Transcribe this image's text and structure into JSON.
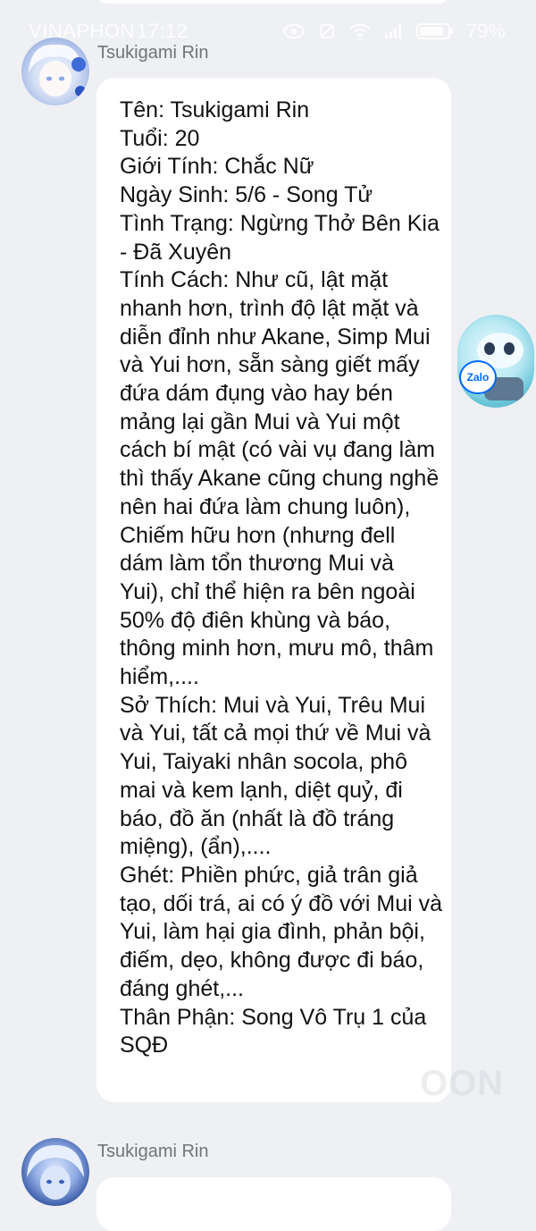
{
  "status_bar": {
    "carrier": "VINAPHON",
    "time": "17:12",
    "battery": "79%"
  },
  "icons": {
    "eye": "eye-icon",
    "mute": "alarm-off-icon",
    "wifi": "wifi-icon",
    "signal": "signal-icon",
    "battery": "battery-icon"
  },
  "chat": {
    "messages": [
      {
        "sender": "Tsukigami Rin",
        "text": "Tên: Tsukigami Rin\nTuổi: 20\nGiới Tính: Chắc Nữ\nNgày Sinh: 5/6 - Song Tử\nTình Trạng: Ngừng Thở Bên Kia - Đã Xuyên\nTính Cách: Như cũ, lật mặt nhanh hơn, trình độ lật mặt và diễn đỉnh như Akane, Simp Mui và Yui hơn, sẵn sàng giết mấy đứa dám đụng vào hay bén mảng lại gần Mui và Yui một cách bí mật (có vài vụ đang làm thì thấy Akane cũng chung nghề nên hai đứa làm chung luôn), Chiếm hữu hơn (nhưng đell dám làm tổn thương Mui và Yui), chỉ thể hiện ra bên ngoài 50% độ điên khùng và báo, thông minh hơn, mưu mô, thâm hiểm,....\nSở Thích: Mui và Yui, Trêu Mui và Yui, tất cả mọi thứ về Mui và Yui, Taiyaki nhân socola, phô mai và kem lạnh, diệt quỷ, đi báo, đồ ăn (nhất là đồ tráng miệng), (ẩn),....\nGhét: Phiền phức, giả trân giả tạo, dối trá, ai có ý đồ với Mui và Yui, làm hại gia đình, phản bội, điếm, dẹo, không được đi báo, đáng ghét,...\nThân Phận: Song Vô Trụ 1 của SQĐ"
      },
      {
        "sender": "Tsukigami Rin"
      }
    ]
  },
  "zalo_bubble": {
    "label": "Zalo"
  },
  "watermark": {
    "text": "OON"
  }
}
